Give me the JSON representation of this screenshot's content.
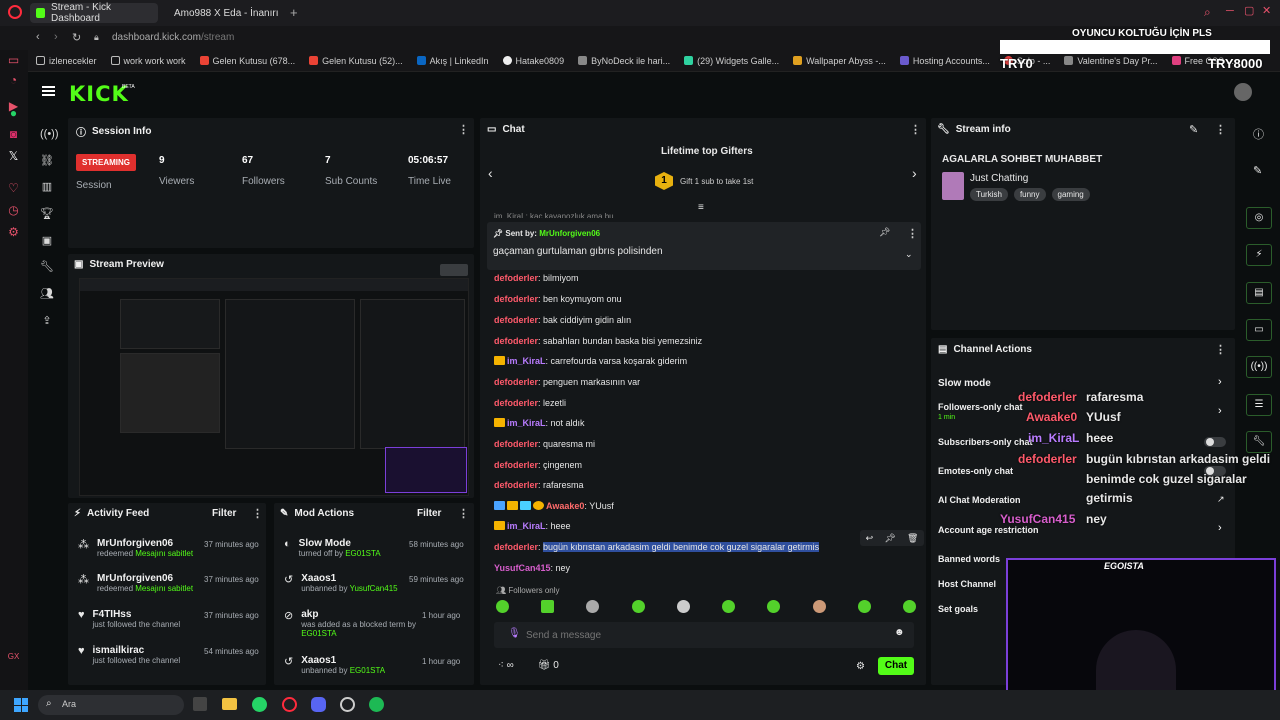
{
  "browser": {
    "tabs": [
      {
        "label": "Stream - Kick Dashboard"
      },
      {
        "label": "Amo988 X Eda - İnanırım..."
      }
    ],
    "url_host": "dashboard.kick.com",
    "url_path": "/stream",
    "bookmarks": [
      "izlenecekler",
      "work work work",
      "Gelen Kutusu (678...",
      "Gelen Kutusu (52)...",
      "Akış | LinkedIn",
      "Hatake0809",
      "ByNoDeck ile hari...",
      "(29) Widgets Galle...",
      "Wallpaper Abyss -...",
      "Hosting Accounts...",
      "Solo - ...",
      "Valentine's Day Pr...",
      "Free CSS ..."
    ]
  },
  "overlay_top": {
    "line1": "OYUNCU KOLTUĞU İÇİN PLS",
    "left": "TRY0",
    "right": "TRY8000"
  },
  "session": {
    "title": "Session Info",
    "status": "STREAMING",
    "status_label": "Session",
    "stats": [
      {
        "value": "9",
        "label": "Viewers"
      },
      {
        "value": "67",
        "label": "Followers"
      },
      {
        "value": "7",
        "label": "Sub Counts"
      },
      {
        "value": "05:06:57",
        "label": "Time Live"
      }
    ]
  },
  "preview": {
    "title": "Stream Preview"
  },
  "activity": {
    "title": "Activity Feed",
    "filter": "Filter",
    "items": [
      {
        "name": "MrUnforgiven06",
        "sub": "redeemed",
        "sub_highlight": "Mesajını sabitlet",
        "time": "37 minutes ago",
        "icon": "redeem-icon"
      },
      {
        "name": "MrUnforgiven06",
        "sub": "redeemed",
        "sub_highlight": "Mesajını sabitlet",
        "time": "37 minutes ago",
        "icon": "redeem-icon"
      },
      {
        "name": "F4TIHss",
        "sub": "just followed the channel",
        "sub_highlight": "",
        "time": "37 minutes ago",
        "icon": "heart-icon"
      },
      {
        "name": "ismailkirac",
        "sub": "just followed the channel",
        "sub_highlight": "",
        "time": "54 minutes ago",
        "icon": "heart-icon"
      }
    ]
  },
  "mod": {
    "title": "Mod Actions",
    "filter": "Filter",
    "items": [
      {
        "name": "Slow Mode",
        "sub": "turned off by",
        "by": "EG01STA",
        "time": "58 minutes ago"
      },
      {
        "name": "Xaaos1",
        "sub": "unbanned by",
        "by": "YusufCan415",
        "time": "59 minutes ago"
      },
      {
        "name": "akp",
        "sub": "was added as a blocked term by",
        "by": "EG01STA",
        "time": "1 hour ago"
      },
      {
        "name": "Xaaos1",
        "sub": "unbanned by",
        "by": "EG01STA",
        "time": "1 hour ago"
      }
    ]
  },
  "chat": {
    "title": "Chat",
    "gifters_title": "Lifetime top Gifters",
    "gifters_sub": "Gift 1 sub to take 1st",
    "partial_line": "im_KiraL: kac kavanozluk ama bu",
    "pinned_by_label": "Sent by",
    "pinned_by": "MrUnforgiven06",
    "pinned_msg": "gaçaman gurtulaman gıbrıs polisinden",
    "messages": [
      {
        "user": "defoderler",
        "text": "bilmiyom",
        "style": "red",
        "crown": false
      },
      {
        "user": "defoderler",
        "text": "ben koymuyom onu",
        "style": "red",
        "crown": false
      },
      {
        "user": "defoderler",
        "text": "bak ciddiyim gidin alın",
        "style": "red",
        "crown": false
      },
      {
        "user": "defoderler",
        "text": "sabahları bundan baska bisi yemezsiniz",
        "style": "red",
        "crown": false
      },
      {
        "user": "im_KiraL",
        "text": "carrefourda varsa koşarak giderim",
        "style": "purple",
        "crown": true
      },
      {
        "user": "defoderler",
        "text": "penguen markasının var",
        "style": "red",
        "crown": false
      },
      {
        "user": "defoderler",
        "text": "lezetli",
        "style": "red",
        "crown": false
      },
      {
        "user": "im_KiraL",
        "text": "not aldık",
        "style": "purple",
        "crown": true
      },
      {
        "user": "defoderler",
        "text": "quaresma mi",
        "style": "red",
        "crown": false
      },
      {
        "user": "defoderler",
        "text": "çingenem",
        "style": "red",
        "crown": false
      },
      {
        "user": "defoderler",
        "text": "rafaresma",
        "style": "red",
        "crown": false
      },
      {
        "user": "Awaake0",
        "text": "YUusf",
        "style": "red",
        "crown": true
      },
      {
        "user": "im_KiraL",
        "text": "heee",
        "style": "purple",
        "crown": true
      },
      {
        "user": "defoderler",
        "text": "bugün kıbrıstan arkadasim geldi benimde cok guzel sigaralar getirmis",
        "style": "red",
        "crown": false
      },
      {
        "user": "YusufCan415",
        "text": "ney",
        "style": "pink2",
        "crown": false
      }
    ],
    "followers_only": "Followers only",
    "placeholder": "Send a message",
    "infinity": "∞",
    "gift_count": "0",
    "send": "Chat"
  },
  "stream_info": {
    "title": "Stream info",
    "stream_title": "AGALARLA SOHBET MUHABBET",
    "category": "Just Chatting",
    "tags": [
      "Turkish",
      "funny",
      "gaming"
    ]
  },
  "channel_actions": {
    "title": "Channel Actions",
    "items": [
      {
        "label": "Slow mode",
        "sub": ""
      },
      {
        "label": "Followers-only chat",
        "sub": "1 min"
      },
      {
        "label": "Subscribers-only chat",
        "sub": ""
      },
      {
        "label": "Emotes-only chat",
        "sub": ""
      },
      {
        "label": "AI Chat Moderation",
        "sub": ""
      },
      {
        "label": "Account age restriction",
        "sub": ""
      },
      {
        "label": "Banned words",
        "sub": ""
      },
      {
        "label": "Host Channel",
        "sub": ""
      },
      {
        "label": "Set goals",
        "sub": ""
      }
    ]
  },
  "overlay_chat": [
    {
      "user": "defoderler",
      "text": "rafaresma"
    },
    {
      "user": "Awaake0",
      "text": "YUusf"
    },
    {
      "user": "im_KiraL",
      "text": "heee"
    },
    {
      "user": "defoderler",
      "text": "bugün kıbrıstan arkadasim geldi"
    },
    {
      "user": "",
      "text": "benimde cok guzel sigaralar"
    },
    {
      "user": "",
      "text": "getirmis"
    },
    {
      "user": "YusufCan415",
      "text": "ney"
    }
  ],
  "webcam_label": "EGOISTA",
  "taskbar": {
    "search_placeholder": "Ara"
  },
  "colors": {
    "brand": "#53fc18",
    "streaming": "#e0302e",
    "chat_user": "#ff5a6b"
  }
}
